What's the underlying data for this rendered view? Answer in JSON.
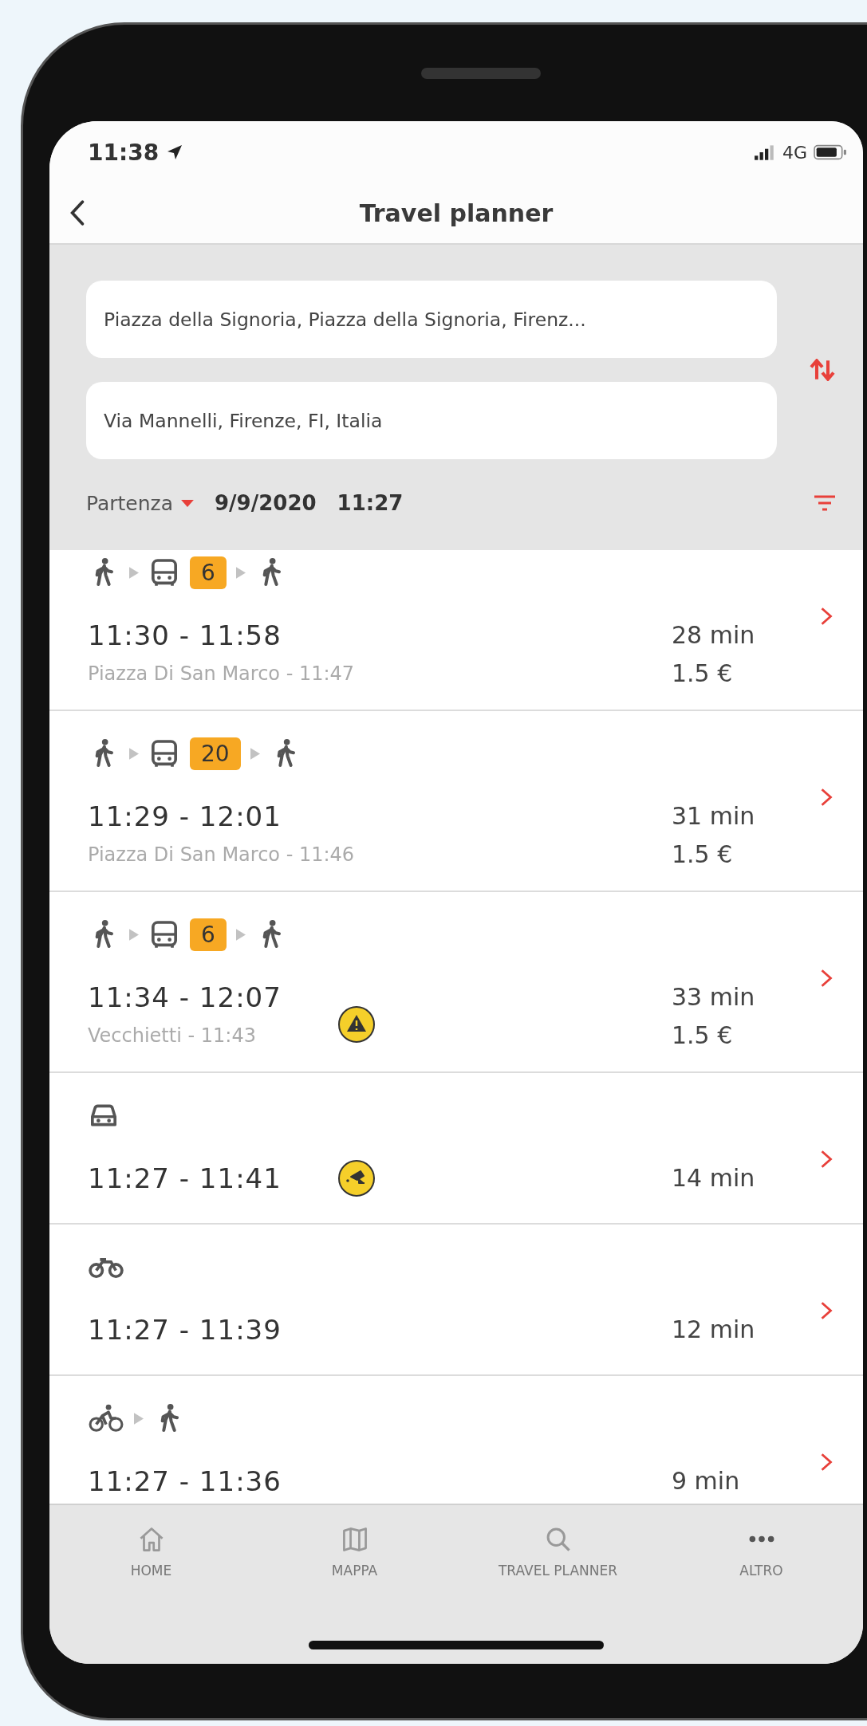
{
  "status_bar": {
    "time": "11:38",
    "network": "4G"
  },
  "header": {
    "title": "Travel planner"
  },
  "search": {
    "origin": "Piazza della Signoria, Piazza della Signoria, Firenz...",
    "destination": "Via Mannelli, Firenze, FI, Italia",
    "mode_label": "Partenza",
    "date": "9/9/2020",
    "time": "11:27"
  },
  "results": [
    {
      "legs": [
        {
          "kind": "walk"
        },
        {
          "kind": "bus",
          "line": "6"
        },
        {
          "kind": "walk"
        }
      ],
      "times": "11:30 - 11:58",
      "stop": "Piazza Di San Marco - 11:47",
      "duration": "28 min",
      "price": "1.5 €"
    },
    {
      "legs": [
        {
          "kind": "walk"
        },
        {
          "kind": "bus",
          "line": "20"
        },
        {
          "kind": "walk"
        }
      ],
      "times": "11:29 - 12:01",
      "stop": "Piazza Di San Marco - 11:46",
      "duration": "31 min",
      "price": "1.5 €"
    },
    {
      "legs": [
        {
          "kind": "walk"
        },
        {
          "kind": "bus",
          "line": "6"
        },
        {
          "kind": "walk"
        }
      ],
      "times": "11:34 - 12:07",
      "stop": "Vecchietti - 11:43",
      "duration": "33 min",
      "price": "1.5 €",
      "alert": {
        "kind": "warning"
      }
    },
    {
      "legs": [
        {
          "kind": "car"
        }
      ],
      "times": "11:27 - 11:41",
      "duration": "14 min",
      "alert": {
        "kind": "speed_camera"
      }
    },
    {
      "legs": [
        {
          "kind": "bicycle"
        }
      ],
      "times": "11:27 - 11:39",
      "duration": "12 min"
    },
    {
      "legs": [
        {
          "kind": "cyclist"
        },
        {
          "kind": "walk"
        }
      ],
      "times": "11:27 - 11:36",
      "duration": "9 min"
    }
  ],
  "bottom_nav": [
    {
      "kind": "home",
      "label": "HOME"
    },
    {
      "kind": "map",
      "label": "MAPPA"
    },
    {
      "kind": "search",
      "label": "TRAVEL PLANNER"
    },
    {
      "kind": "more",
      "label": "ALTRO"
    }
  ]
}
